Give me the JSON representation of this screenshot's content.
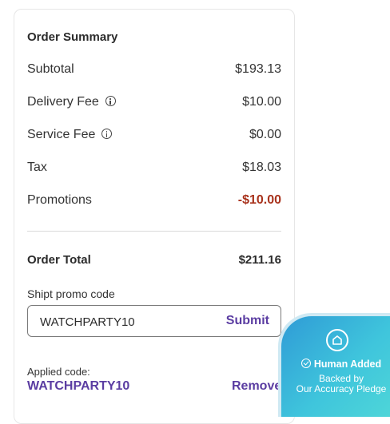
{
  "summary": {
    "title": "Order Summary",
    "subtotal_label": "Subtotal",
    "subtotal_value": "$193.13",
    "delivery_label": "Delivery Fee",
    "delivery_value": "$10.00",
    "service_label": "Service Fee",
    "service_value": "$0.00",
    "tax_label": "Tax",
    "tax_value": "$18.03",
    "promotions_label": "Promotions",
    "promotions_value": "-$10.00",
    "total_label": "Order Total",
    "total_value": "$211.16"
  },
  "promo": {
    "label": "Shipt promo code",
    "input_value": "WATCHPARTY10",
    "submit_label": "Submit",
    "applied_label": "Applied code:",
    "applied_code": "WATCHPARTY10",
    "remove_label": "Remove"
  },
  "badge": {
    "line1": "Human Added",
    "line2a": "Backed by",
    "line2b": "Our Accuracy Pledge"
  },
  "colors": {
    "accent": "#5b3da2",
    "promo_negative": "#a8321c",
    "badge_gradient_start": "#2f9bd6",
    "badge_gradient_end": "#4fd7d8"
  },
  "icons": [
    "info-icon",
    "check-circle-icon",
    "house-shield-icon"
  ]
}
